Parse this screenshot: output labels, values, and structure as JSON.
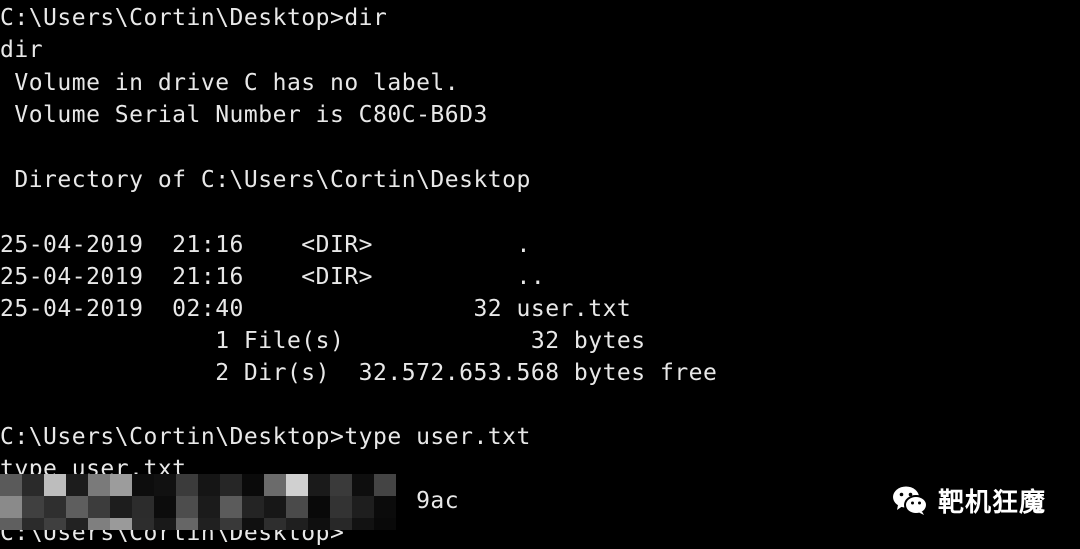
{
  "terminal": {
    "lines": [
      "C:\\Users\\Cortin\\Desktop>dir",
      "dir",
      " Volume in drive C has no label.",
      " Volume Serial Number is C80C-B6D3",
      "",
      " Directory of C:\\Users\\Cortin\\Desktop",
      "",
      "25-04-2019  21:16    <DIR>          .",
      "25-04-2019  21:16    <DIR>          ..",
      "25-04-2019  02:40                32 user.txt",
      "               1 File(s)             32 bytes",
      "               2 Dir(s)  32.572.653.568 bytes free",
      "",
      "C:\\Users\\Cortin\\Desktop>type user.txt",
      "type user.txt",
      "                             9ac",
      "C:\\Users\\Cortin\\Desktop>"
    ],
    "text_color": "#e8e8e8",
    "background": "#000000"
  },
  "redaction": {
    "label": "pixelated-hash",
    "visible_suffix": "9ac"
  },
  "watermark": {
    "text": "靶机狂魔",
    "icon": "wechat-icon"
  }
}
